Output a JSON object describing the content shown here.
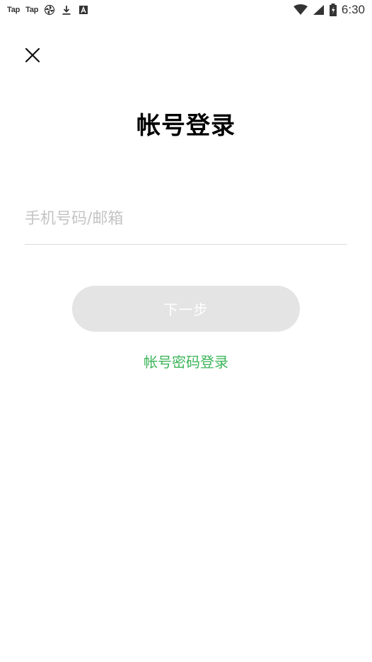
{
  "status_bar": {
    "left_labels": [
      "Tap",
      "Tap"
    ],
    "time": "6:30",
    "icons": [
      "pinwheel-icon",
      "download-icon",
      "a-box-icon",
      "wifi-icon",
      "cell-signal-icon",
      "battery-icon"
    ]
  },
  "header": {
    "close_icon": "close-icon",
    "title": "帐号登录"
  },
  "form": {
    "phone_input": {
      "value": "",
      "placeholder": "手机号码/邮箱"
    },
    "next_button_label": "下一步",
    "password_login_label": "帐号密码登录"
  },
  "colors": {
    "accent_green": "#3cb55a",
    "button_disabled_bg": "#e4e4e4",
    "placeholder": "#c4c4c4",
    "divider": "#dcdcdc"
  }
}
